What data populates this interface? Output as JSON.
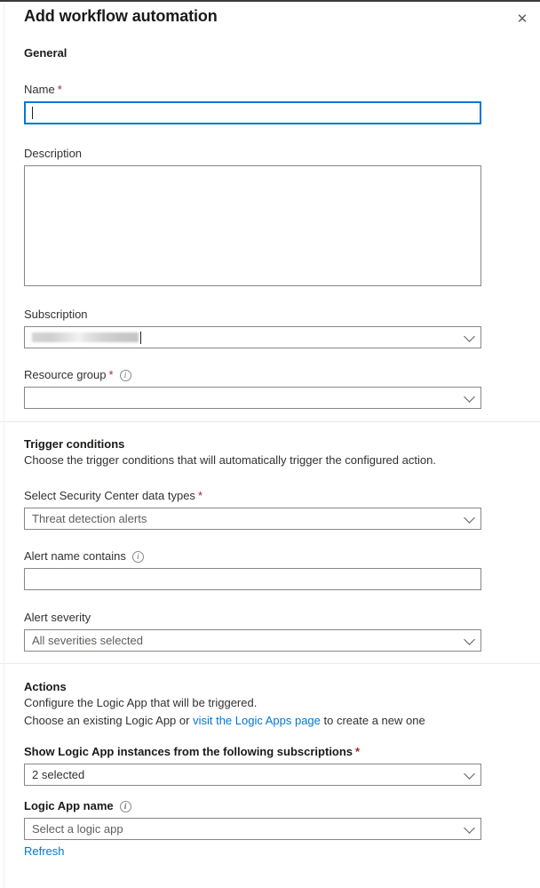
{
  "panel": {
    "title": "Add workflow automation",
    "close_icon": "close-icon"
  },
  "general": {
    "heading": "General",
    "name": {
      "label": "Name",
      "required": "*",
      "value": ""
    },
    "description": {
      "label": "Description",
      "value": ""
    },
    "subscription": {
      "label": "Subscription",
      "value": "",
      "redacted": true,
      "caret_icon": "chevron-down-icon"
    },
    "resource_group": {
      "label": "Resource group",
      "required": "*",
      "info_icon": "info-icon",
      "value": "",
      "caret_icon": "chevron-down-icon"
    }
  },
  "trigger_conditions": {
    "heading": "Trigger conditions",
    "description": "Choose the trigger conditions that will automatically trigger the configured action.",
    "data_types": {
      "label": "Select Security Center data types",
      "required": "*",
      "value": "Threat detection alerts",
      "caret_icon": "chevron-down-icon"
    },
    "alert_name_contains": {
      "label": "Alert name contains",
      "info_icon": "info-icon",
      "value": ""
    },
    "alert_severity": {
      "label": "Alert severity",
      "value": "All severities selected",
      "caret_icon": "chevron-down-icon"
    }
  },
  "actions": {
    "heading": "Actions",
    "description_line1": "Configure the Logic App that will be triggered.",
    "description_line2_prefix": "Choose an existing Logic App or ",
    "description_link": "visit the Logic Apps page",
    "description_line2_suffix": " to create a new one",
    "subscriptions": {
      "label": "Show Logic App instances from the following subscriptions",
      "required": "*",
      "value": "2 selected",
      "caret_icon": "chevron-down-icon"
    },
    "logic_app_name": {
      "label": "Logic App name",
      "info_icon": "info-icon",
      "value": "Select a logic app",
      "caret_icon": "chevron-down-icon"
    },
    "refresh_link": "Refresh"
  },
  "colors": {
    "accent": "#0078d4",
    "required": "#a4262c",
    "border": "#8a8886",
    "divider": "#edebe9"
  }
}
